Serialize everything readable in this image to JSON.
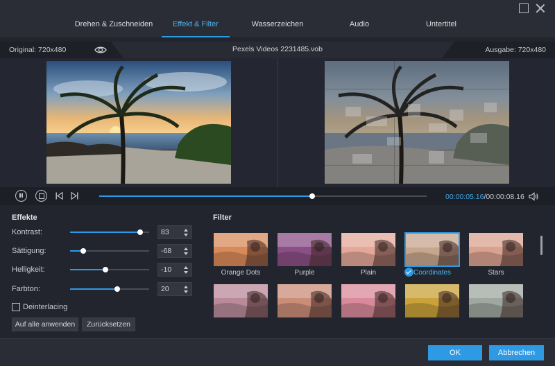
{
  "tabs": [
    {
      "label": "Drehen & Zuschneiden",
      "active": false
    },
    {
      "label": "Effekt & Filter",
      "active": true
    },
    {
      "label": "Wasserzeichen",
      "active": false
    },
    {
      "label": "Audio",
      "active": false
    },
    {
      "label": "Untertitel",
      "active": false
    }
  ],
  "infobar": {
    "original": "Original: 720x480",
    "filename": "Pexels Videos 2231485.vob",
    "output": "Ausgabe: 720x480"
  },
  "playback": {
    "current_time": "00:00:05.16",
    "total_time": "/00:00:08.16",
    "progress": 0.65
  },
  "effects": {
    "title": "Effekte",
    "sliders": [
      {
        "label": "Kontrast:",
        "value": "83",
        "fraction": 0.89
      },
      {
        "label": "Sättigung:",
        "value": "-68",
        "fraction": 0.17
      },
      {
        "label": "Helligkeit:",
        "value": "-10",
        "fraction": 0.45
      },
      {
        "label": "Farbton:",
        "value": "20",
        "fraction": 0.6
      }
    ],
    "deinterlacing": "Deinterlacing",
    "deinterlacing_checked": false,
    "apply_all": "Auf alle anwenden",
    "reset": "Zurücksetzen"
  },
  "filter": {
    "title": "Filter",
    "items": [
      {
        "name": "Orange Dots",
        "tint": "#d98a5a",
        "selected": false
      },
      {
        "name": "Purple",
        "tint": "#8a4f86",
        "selected": false
      },
      {
        "name": "Plain",
        "tint": "#e3a89a",
        "selected": false
      },
      {
        "name": "Coordinates",
        "tint": "#c7a68e",
        "selected": true
      },
      {
        "name": "Stars",
        "tint": "#d9a28f",
        "selected": false
      },
      {
        "name": "",
        "tint": "#b88a9a",
        "selected": false
      },
      {
        "name": "",
        "tint": "#c98d78",
        "selected": false
      },
      {
        "name": "",
        "tint": "#d98a9a",
        "selected": false
      },
      {
        "name": "",
        "tint": "#c9a23a",
        "selected": false
      },
      {
        "name": "",
        "tint": "#9fa8a0",
        "selected": false
      }
    ]
  },
  "footer": {
    "ok": "OK",
    "cancel": "Abbrechen"
  },
  "colors": {
    "accent": "#2f9ae4",
    "background": "#22252e"
  }
}
